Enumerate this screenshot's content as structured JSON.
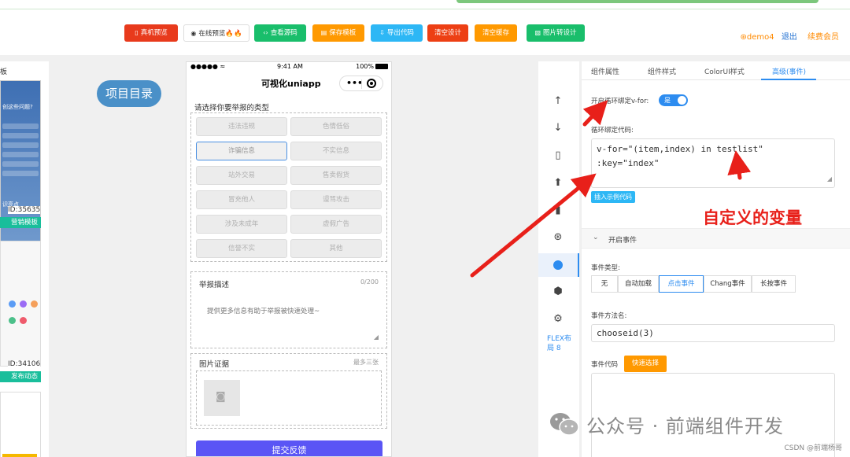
{
  "toolbar": {
    "buttons": [
      {
        "label": "真机预览",
        "icon": "▯",
        "color": "#e83a1c",
        "text_color": "#ffffff"
      },
      {
        "label": "在线预览🔥🔥",
        "icon": "◉",
        "color": "#ffffff",
        "text_color": "#333333"
      },
      {
        "label": "查看源码",
        "icon": "‹›",
        "color": "#19be6b",
        "text_color": "#ffffff"
      },
      {
        "label": "保存模板",
        "icon": "▤",
        "color": "#ff9900",
        "text_color": "#ffffff"
      },
      {
        "label": "导出代码",
        "icon": "⇩",
        "color": "#2db7f5",
        "text_color": "#ffffff"
      },
      {
        "label": "清空设计",
        "icon": "",
        "color": "#ed3f14",
        "text_color": "#ffffff"
      },
      {
        "label": "清空缓存",
        "icon": "",
        "color": "#ff9900",
        "text_color": "#ffffff"
      },
      {
        "label": "图片转设计",
        "icon": "▧",
        "color": "#19be6b",
        "text_color": "#ffffff"
      }
    ],
    "user": {
      "name": "demo4",
      "logout": "退出",
      "renew": "续费会员",
      "icon": "⊛"
    }
  },
  "left_panel": {
    "title": "板",
    "templates": [
      {
        "id": "ID:35635",
        "label": "营销模板",
        "lines": [
          "创这些问题?",
          "识亮点"
        ]
      },
      {
        "id": "ID:34106",
        "label": "发布动态"
      }
    ]
  },
  "catalog": {
    "label": "项目目录"
  },
  "phone": {
    "status": {
      "signal": "●●●●● ≈",
      "time": "9:41 AM",
      "battery": "100%"
    },
    "title": "可视化uniapp",
    "report_type_title": "请选择你要举报的类型",
    "types": [
      "违法违规",
      "色情低俗",
      "诈骗信息",
      "不实信息",
      "站外交易",
      "售卖假货",
      "冒充他人",
      "谩骂攻击",
      "涉及未成年",
      "虚假广告",
      "信誉不实",
      "其他"
    ],
    "selected_type": "诈骗信息",
    "desc_title": "举报描述",
    "desc_counter": "0/200",
    "desc_placeholder": "提供更多信息有助于举报被快速处理~",
    "evidence_title": "图片证据",
    "evidence_hint": "最多三张",
    "submit": "提交反馈"
  },
  "icon_strip": {
    "icons": [
      "arrow-up-icon",
      "arrow-down-icon",
      "copy-icon",
      "up-circle-icon",
      "trash-icon",
      "aperture-icon",
      "active-circle-icon",
      "angular-icon",
      "gear-icon"
    ],
    "flex_label_line1": "FLEX布",
    "flex_label_line2": "局 8"
  },
  "props": {
    "tabs": [
      "组件属性",
      "组件样式",
      "ColorUI样式",
      "高级(事件)"
    ],
    "active_tab": "高级(事件)",
    "loop_label": "开启循环绑定v-for:",
    "toggle_text": "是",
    "loop_code_label": "循环绑定代码:",
    "loop_code_line1": "v-for=\"(item,index) in testlist\"",
    "loop_code_line2": ":key=\"index\"",
    "insert_example": "插入示例代码",
    "annotation": "自定义的变量",
    "events_section": "开启事件",
    "event_type_label": "事件类型:",
    "event_types": [
      "无",
      "自动加载",
      "点击事件",
      "Chang事件",
      "长按事件"
    ],
    "active_event": "点击事件",
    "method_label": "事件方法名:",
    "method_value": "chooseid(3)",
    "event_code_label": "事件代码",
    "quick_select": "快速选择"
  },
  "watermark": {
    "text": "公众号 · 前端组件开发",
    "csdn": "CSDN @前端杨哥"
  },
  "colors": {
    "accent": "#2d8cf0",
    "annotation_red": "#e8201a",
    "submit_purple": "#5a55f5"
  }
}
